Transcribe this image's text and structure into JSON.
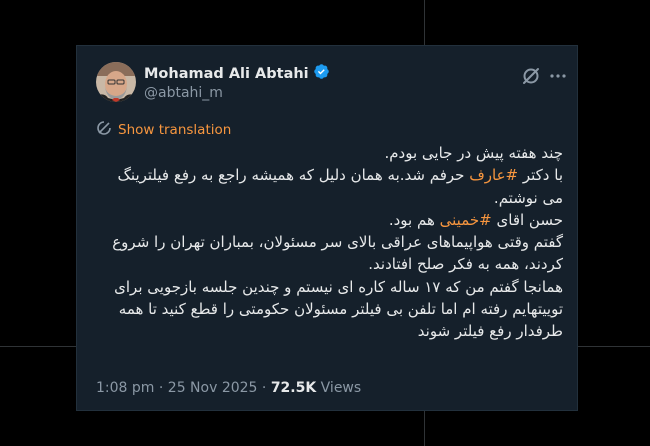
{
  "author": {
    "name": "Mohamad Ali Abtahi",
    "handle": "@abtahi_m",
    "verified": true
  },
  "translate_label": "Show translation",
  "tweet": {
    "l1": "چند هفته پیش در جایی بودم.",
    "l2a": "با دکتر ",
    "h1": "#عارف",
    "l2b": " حرفم شد.به همان دلیل که همیشه راجع به رفع فیلترینگ می نوشتم.",
    "l3a": "حسن اقای ",
    "h2": "#خمینی",
    "l3b": " هم بود.",
    "l4": "گفتم وقتی هواپیماهای عراقی بالای سر مسئولان، بمباران تهران را شروع کردند، همه به فکر صلح افتادند.",
    "l5": "همانجا گفتم من که ۱۷ ساله کاره ای نیستم و چندین جلسه بازجویی برای توییتهایم رفته ام اما تلفن بی فیلتر مسئولان حکومتی را قطع کنید تا همه طرفدار رفع فیلتر شوند"
  },
  "meta": {
    "time": "1:08 pm",
    "date": "25 Nov 2025",
    "views_count": "72.5K",
    "views_label": "Views"
  },
  "colors": {
    "background": "#000000",
    "card": "#15202b",
    "accent": "#f7963f",
    "verified": "#1d9bf0",
    "text": "#e7e9ea",
    "muted": "#8b98a5"
  },
  "icons": [
    "verified-badge-icon",
    "grok-icon",
    "more-icon",
    "translate-icon"
  ]
}
